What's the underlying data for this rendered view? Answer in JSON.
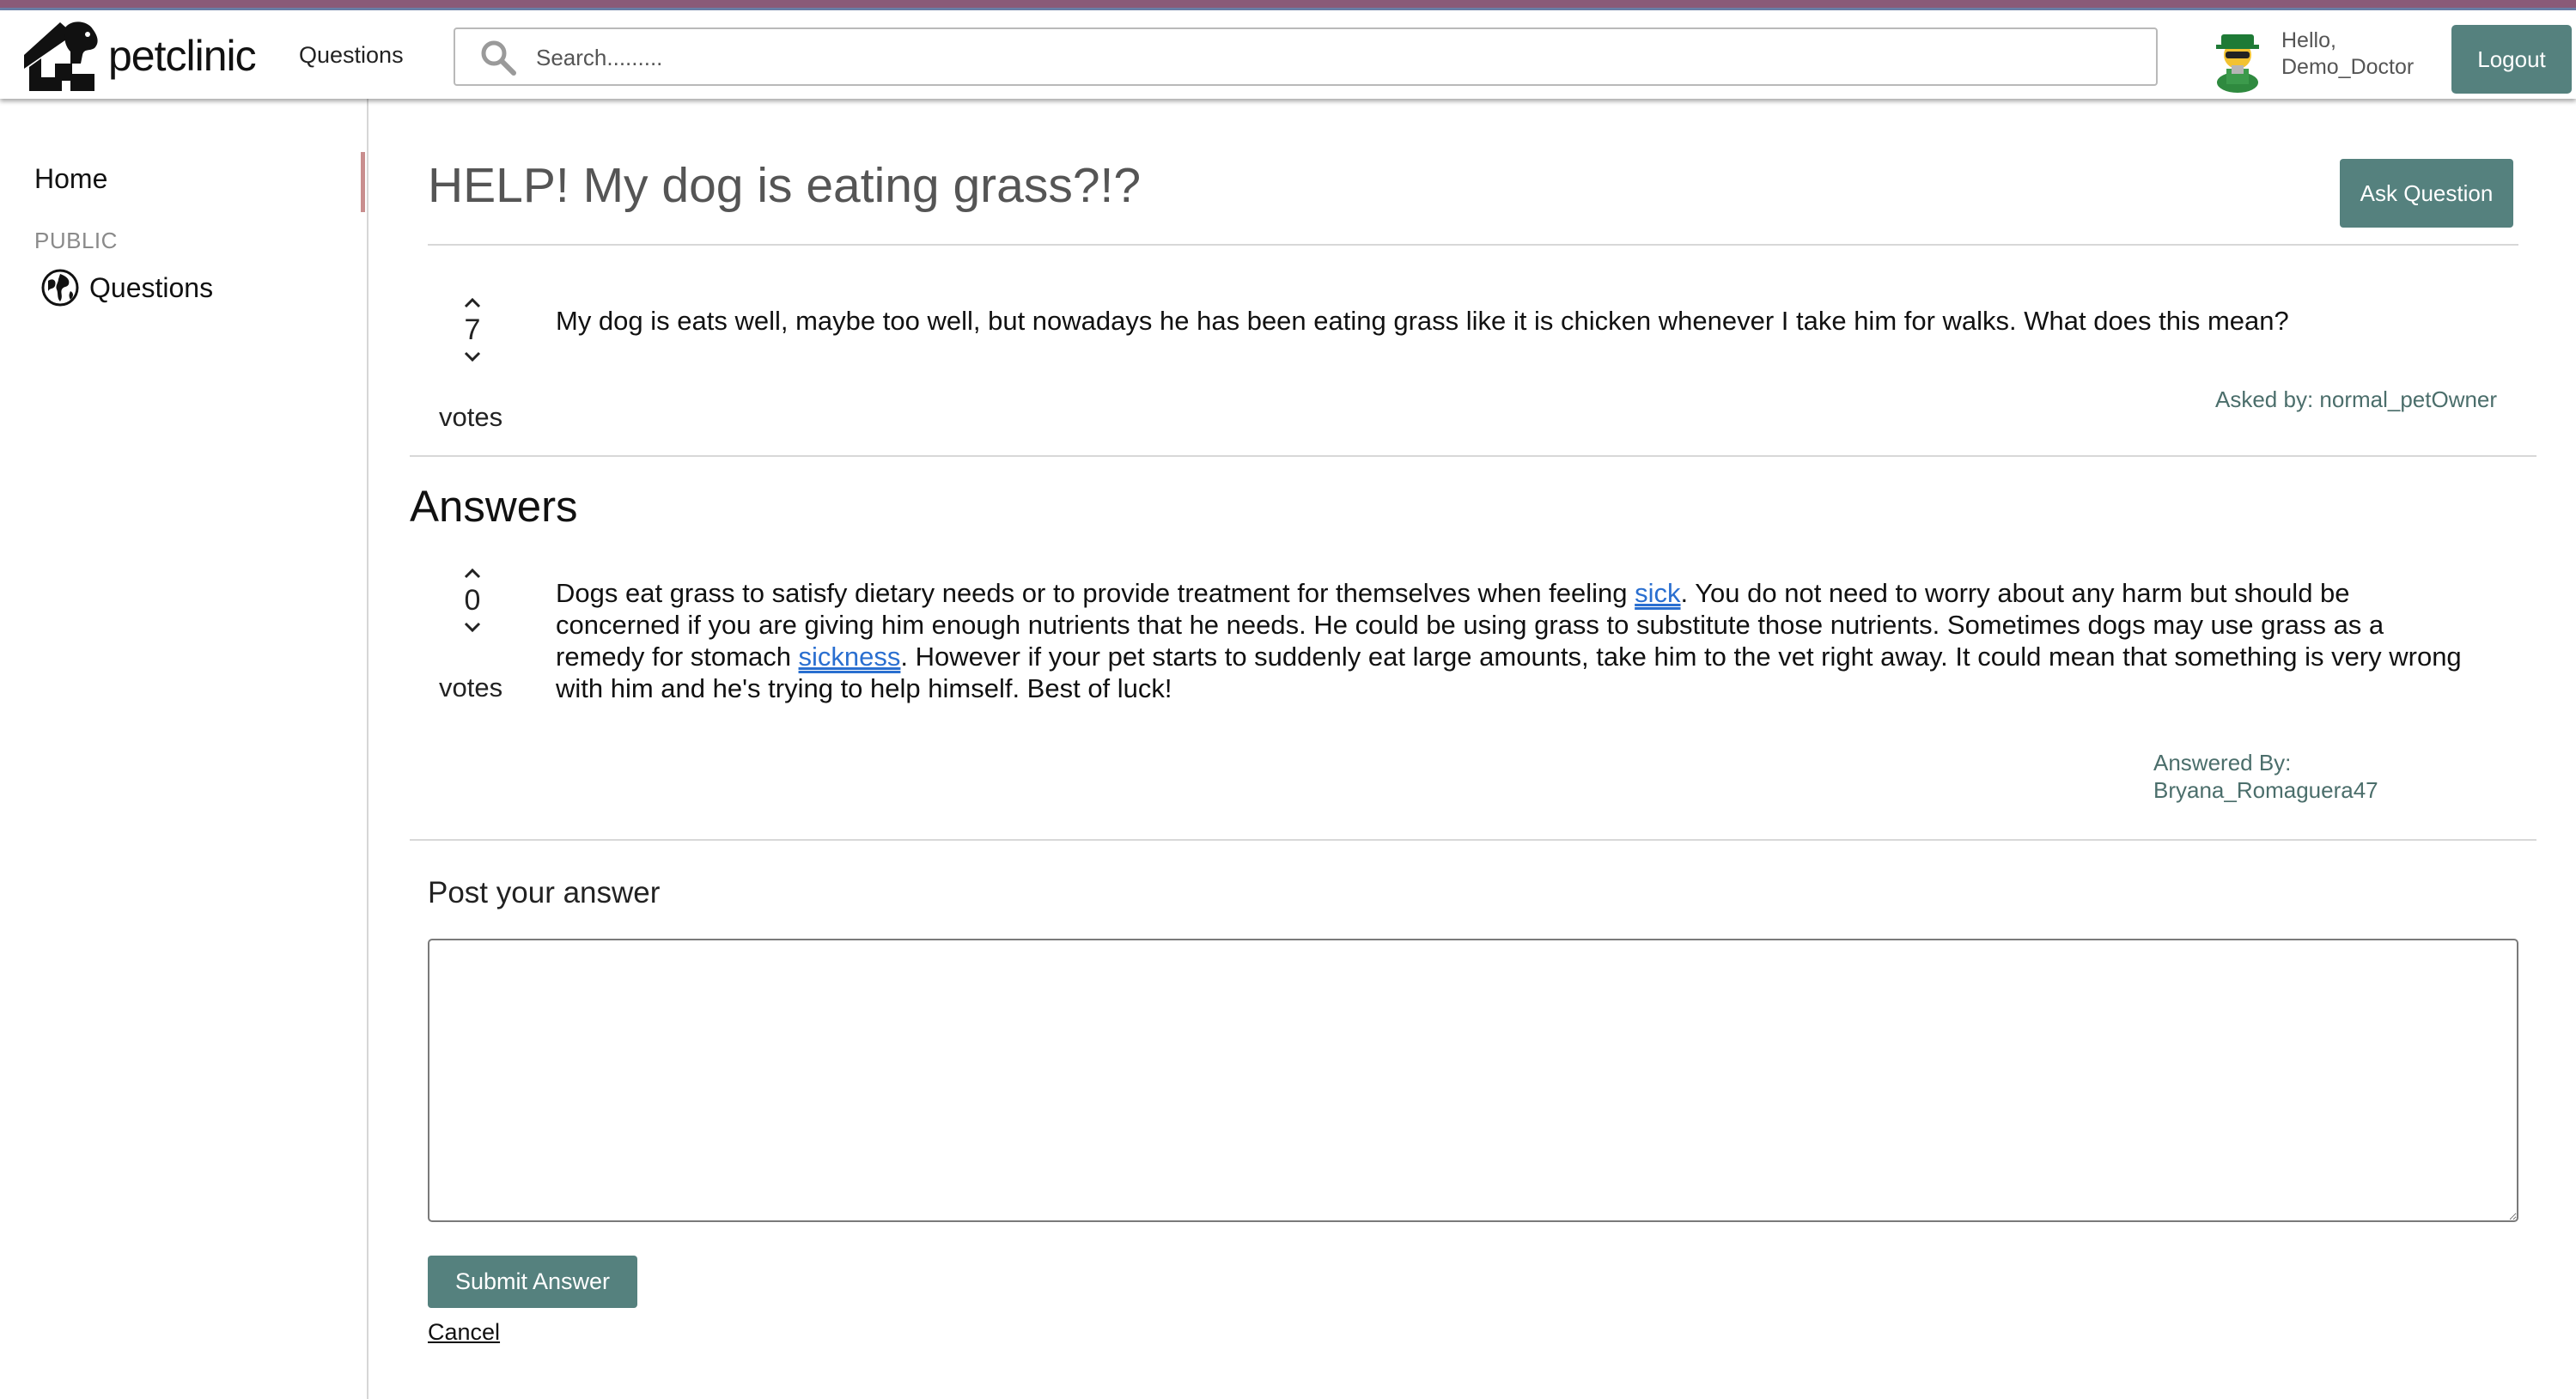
{
  "header": {
    "brand": "petclinic",
    "nav_questions": "Questions",
    "search_placeholder": "Search.........",
    "greeting_line1": "Hello,",
    "greeting_line2": "Demo_Doctor",
    "logout_label": "Logout"
  },
  "sidebar": {
    "home": "Home",
    "section_public": "PUBLIC",
    "questions": "Questions"
  },
  "question": {
    "title": "HELP! My dog is eating grass?!?",
    "ask_button": "Ask Question",
    "votes": "7",
    "votes_label": "votes",
    "body": "My dog is eats well, maybe too well, but nowadays he has been eating grass like it is chicken whenever I take him for walks. What does this mean?",
    "asked_by": "Asked by: normal_petOwner"
  },
  "answers": {
    "heading": "Answers",
    "items": [
      {
        "votes": "0",
        "votes_label": "votes",
        "text_part1": "Dogs eat grass to satisfy dietary needs or to provide treatment for themselves when feeling ",
        "link1": "sick",
        "text_part2": ". You do not need to worry about any harm but should be concerned if you are giving him enough nutrients that he needs. He could be using grass to substitute those nutrients. Sometimes dogs may use grass as a remedy for stomach ",
        "link2": "sickness",
        "text_part3": ". However if your pet starts to suddenly eat large amounts, take him to the vet right away. It could mean that something is very wrong with him and he's trying to help himself. Best of luck!",
        "answered_by_label": "Answered By:",
        "answered_by_user": "Bryana_Romaguera47"
      }
    ]
  },
  "post_answer": {
    "heading": "Post your answer",
    "textarea_value": "",
    "submit_label": "Submit Answer",
    "cancel_label": "Cancel"
  },
  "colors": {
    "accent_button": "#55817e",
    "link": "#2a6fd0",
    "meta_text": "#4b6e6b",
    "top_stripe": "#8a5a78"
  }
}
